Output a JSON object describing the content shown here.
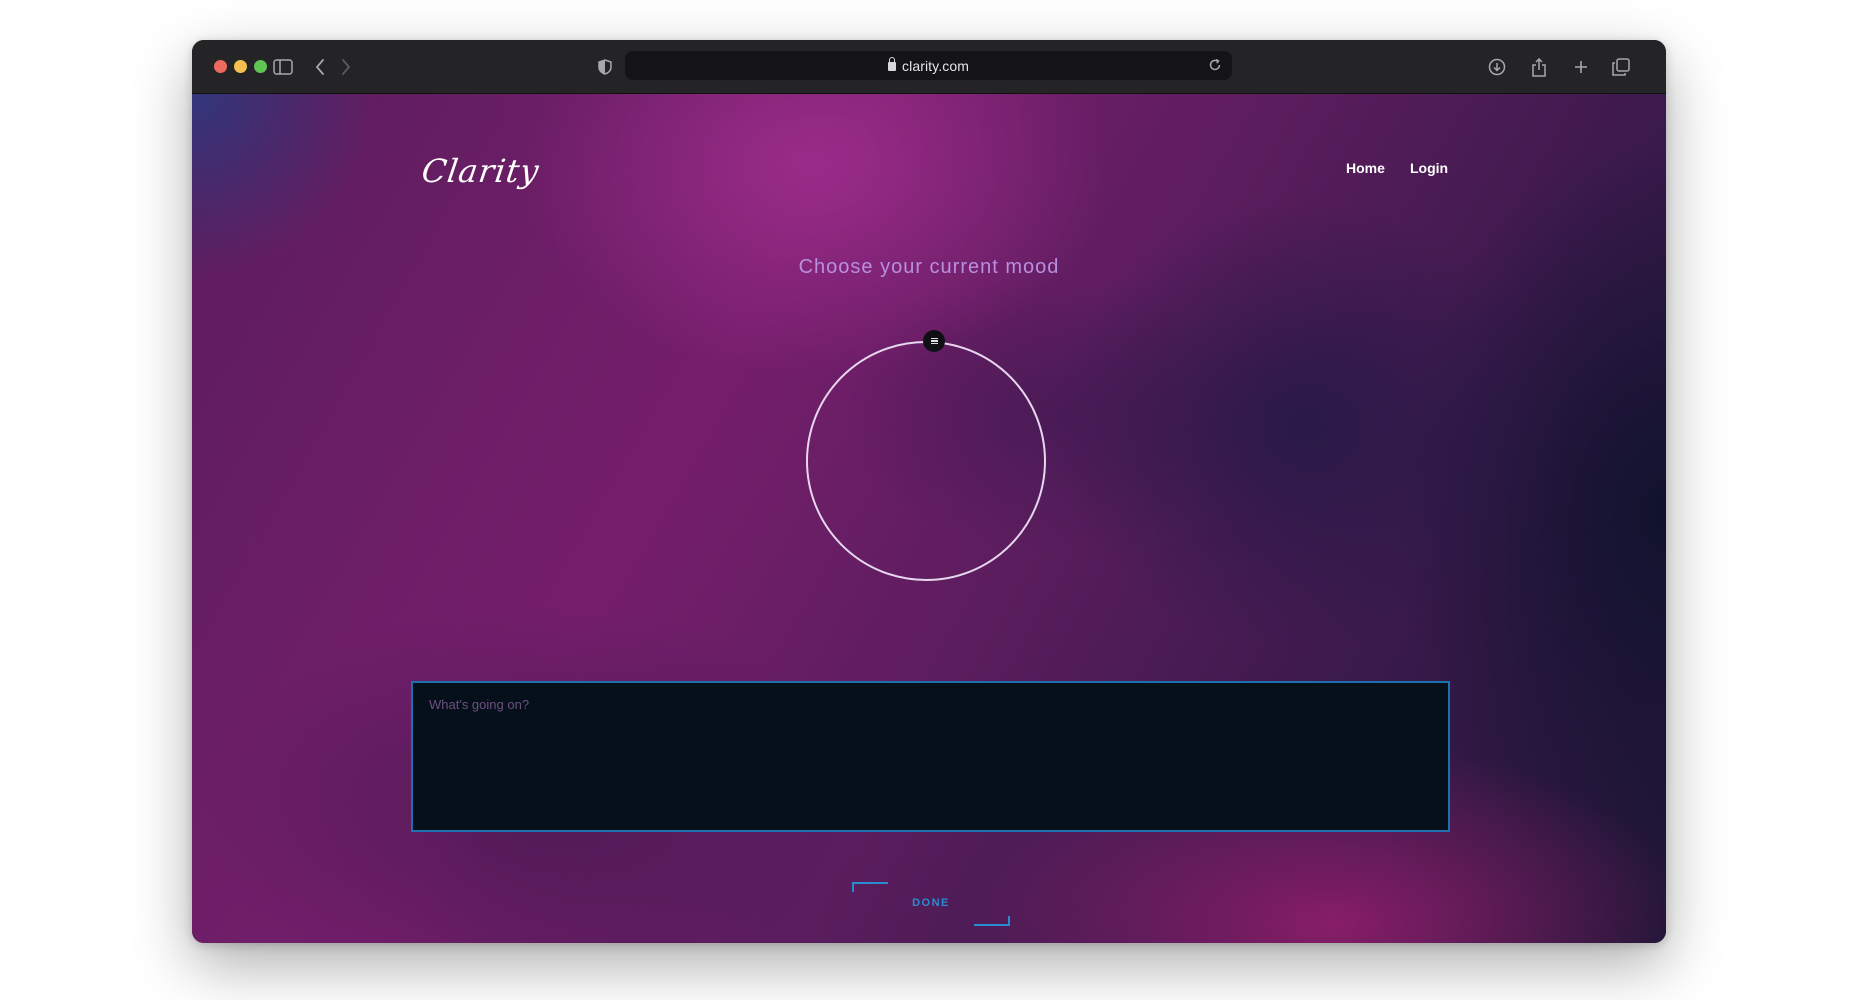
{
  "browser": {
    "url": "clarity.com",
    "colors": {
      "close": "#ed6a5e",
      "minimize": "#f5bf4f",
      "maximize": "#61c554"
    }
  },
  "site": {
    "logo": "Clarity",
    "nav": {
      "home": "Home",
      "login": "Login"
    }
  },
  "main": {
    "heading": "Choose your current mood",
    "textarea_placeholder": "What's going on?",
    "textarea_value": "",
    "done_label": "DONE"
  },
  "colors": {
    "accent": "#2b8bd0",
    "heading": "#b98fe0",
    "textarea_bg": "#06101a"
  },
  "icons": [
    "sidebar-icon",
    "back-icon",
    "forward-icon",
    "shield-icon",
    "lock-icon",
    "reload-icon",
    "download-icon",
    "share-icon",
    "new-tab-icon",
    "tabs-overview-icon",
    "mood-handle-icon"
  ]
}
